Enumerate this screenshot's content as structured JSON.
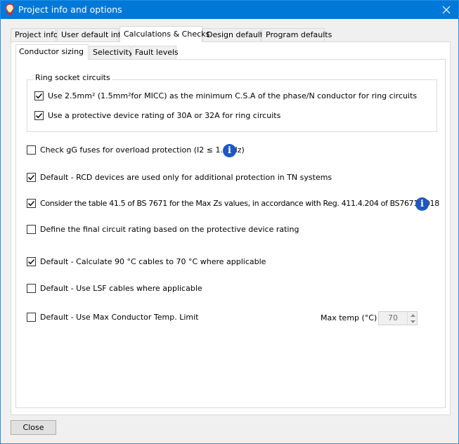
{
  "window": {
    "title": "Project info and options",
    "icon": "lightbulb-icon",
    "accent": "#0078d7"
  },
  "tabs": [
    {
      "label": "Project info"
    },
    {
      "label": "User default info"
    },
    {
      "label": "Calculations & Checks",
      "active": true
    },
    {
      "label": "Design defaults"
    },
    {
      "label": "Program defaults"
    }
  ],
  "subtabs": [
    {
      "label": "Conductor sizing",
      "active": true
    },
    {
      "label": "Selectivity"
    },
    {
      "label": "Fault levels"
    }
  ],
  "ring_group": {
    "title": "Ring socket circuits",
    "items": [
      {
        "label": "Use 2.5mm² (1.5mm²for MICC) as the minimum C.S.A of the phase/N conductor for ring circuits",
        "checked": true
      },
      {
        "label": "Use a protective device rating of 30A or 32A for ring circuits",
        "checked": true
      }
    ]
  },
  "options": [
    {
      "label": "Check gG fuses for overload protection (I2 ≤ 1.45.Iz)",
      "checked": false
    },
    {
      "label": "Default - RCD devices are used only for additional protection in TN systems",
      "checked": true
    },
    {
      "label": "Consider the table 41.5 of BS 7671 for the Max Zs values, in accordance with Reg. 411.4.204 of BS7671:2018",
      "checked": true
    },
    {
      "label": "Define the final circuit rating based on the protective device rating",
      "checked": false
    },
    {
      "label": "Default - Calculate 90 °C cables to 70 °C where applicable",
      "checked": true
    },
    {
      "label": "Default - Use LSF cables where applicable",
      "checked": false
    },
    {
      "label": "Default - Use Max Conductor Temp. Limit",
      "checked": false
    }
  ],
  "max_temp": {
    "label": "Max temp (°C)",
    "value": "70"
  },
  "close_button": "Close"
}
